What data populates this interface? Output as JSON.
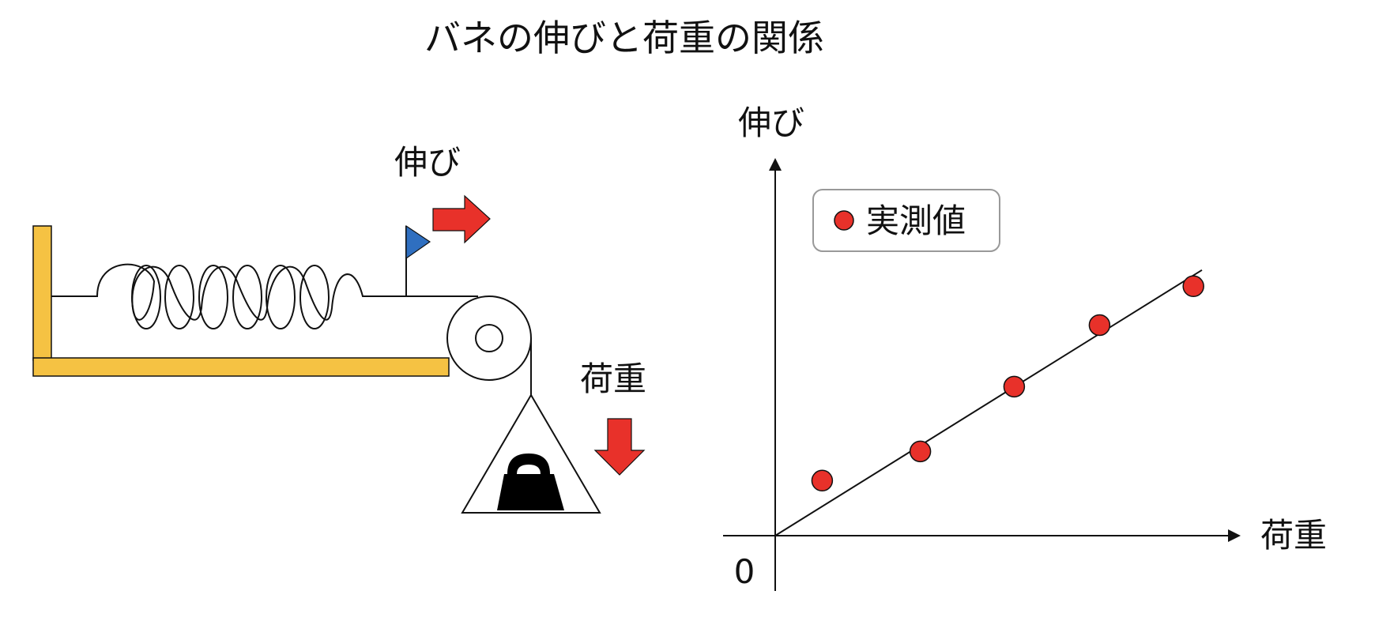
{
  "title": "バネの伸びと荷重の関係",
  "left": {
    "extension_label": "伸び",
    "load_label": "荷重"
  },
  "right": {
    "y_axis_label": "伸び",
    "x_axis_label": "荷重",
    "origin_label": "0",
    "legend_label": "実測値"
  },
  "colors": {
    "wall": "#f5c243",
    "arrow": "#e8312a",
    "flag": "#2f6fc0",
    "point": "#e8312a",
    "weight": "#000000"
  },
  "chart_data": {
    "type": "scatter",
    "title": "",
    "xlabel": "荷重",
    "ylabel": "伸び",
    "series": [
      {
        "name": "実測値",
        "points": [
          [
            0.11,
            0.17
          ],
          [
            0.34,
            0.26
          ],
          [
            0.56,
            0.46
          ],
          [
            0.76,
            0.65
          ],
          [
            0.98,
            0.77
          ]
        ]
      }
    ],
    "fit_line": {
      "slope": 0.82,
      "intercept": 0
    },
    "xlim": [
      0,
      1.05
    ],
    "ylim": [
      0,
      1
    ]
  }
}
